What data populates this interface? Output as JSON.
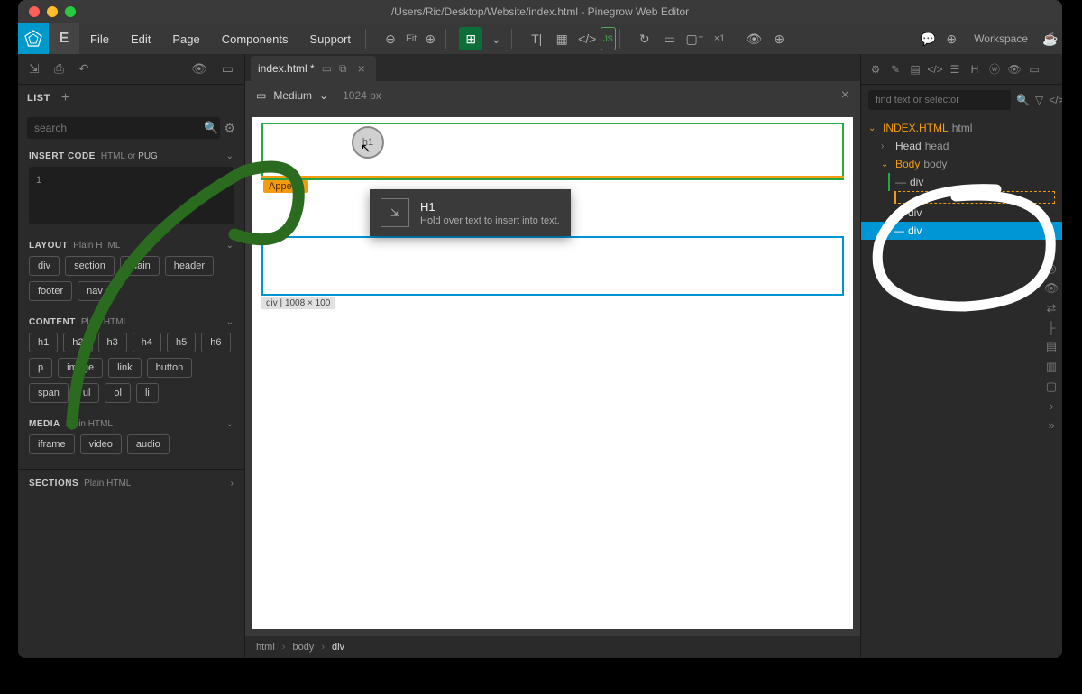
{
  "title": "/Users/Ric/Desktop/Website/index.html - Pinegrow Web Editor",
  "menubar": {
    "logo_char": "❂",
    "e_char": "E",
    "items": [
      "File",
      "Edit",
      "Page",
      "Components",
      "Support"
    ],
    "fit": "Fit",
    "multiplier": "×1",
    "workspace": "Workspace"
  },
  "left_panel": {
    "tab": "LIST",
    "search_placeholder": "search",
    "insert_code": {
      "title": "INSERT CODE",
      "sub": "HTML or",
      "link": "PUG"
    },
    "code_line": "1",
    "layout": {
      "title": "LAYOUT",
      "sub": "Plain HTML",
      "chips": [
        "div",
        "section",
        "main",
        "header",
        "footer",
        "nav"
      ]
    },
    "content": {
      "title": "CONTENT",
      "sub": "Plain HTML",
      "chips": [
        "h1",
        "h2",
        "h3",
        "h4",
        "h5",
        "h6",
        "p",
        "image",
        "link",
        "button",
        "span",
        "ul",
        "ol",
        "li"
      ]
    },
    "media": {
      "title": "MEDIA",
      "sub": "Plain HTML",
      "chips": [
        "iframe",
        "video",
        "audio"
      ]
    },
    "sections": {
      "title": "SECTIONS",
      "sub": "Plain HTML"
    }
  },
  "center": {
    "tab_label": "index.html *",
    "viewport_size": "Medium",
    "viewport_px": "1024 px",
    "append_label": "Append",
    "drag_label": "h1",
    "tooltip_title": "H1",
    "tooltip_sub": "Hold over text to insert into text.",
    "dim_label": "div | 1008 × 100",
    "breadcrumb": [
      "html",
      "body",
      "div"
    ]
  },
  "right_panel": {
    "search_placeholder": "find text or selector",
    "tree": {
      "root_file": "INDEX.HTML",
      "root_tag": "html",
      "head_label": "Head",
      "head_tag": "head",
      "body_label": "Body",
      "body_tag": "body",
      "div_label": "div"
    }
  }
}
